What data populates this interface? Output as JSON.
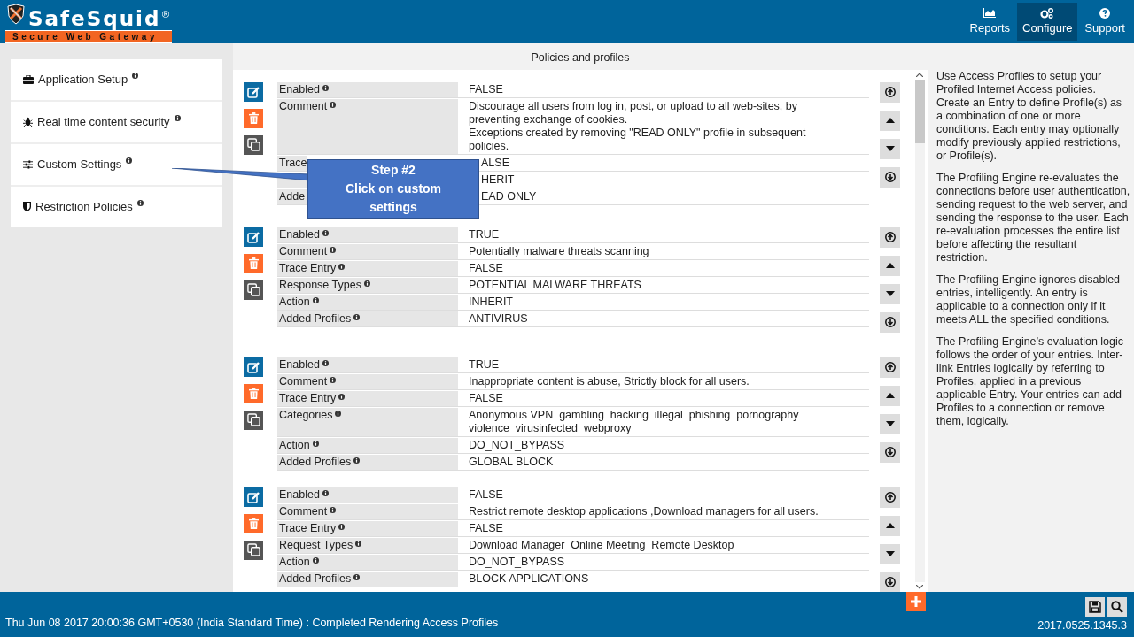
{
  "header": {
    "logo_name": "SafeSquid",
    "logo_mark": "®",
    "logo_tagline": "Secure Web Gateway",
    "nav": [
      {
        "label": "Reports",
        "selected": false
      },
      {
        "label": "Configure",
        "selected": true
      },
      {
        "label": "Support",
        "selected": false
      }
    ]
  },
  "sidebar": {
    "items": [
      {
        "label": "Application Setup"
      },
      {
        "label": "Real time content security"
      },
      {
        "label": "Custom Settings"
      },
      {
        "label": "Restriction Policies"
      }
    ]
  },
  "panel": {
    "title": "Policies and profiles",
    "entries": [
      {
        "rows": [
          {
            "label": "Enabled",
            "value": "FALSE",
            "covered": false
          },
          {
            "label": "Comment",
            "value": "Discourage all users from log in, post, or upload to all web-sites, by preventing exchange of cookies.\nExceptions created by removing \"READ ONLY\" profile in subsequent policies.",
            "covered": false
          },
          {
            "label": "Trace",
            "value": "ALSE",
            "covered": true
          },
          {
            "value": "HERIT",
            "covered": true
          },
          {
            "label": "Adde",
            "value": "EAD ONLY",
            "covered": true
          }
        ]
      },
      {
        "rows": [
          {
            "label": "Enabled",
            "value": "TRUE",
            "covered": false
          },
          {
            "label": "Comment",
            "value": "Potentially malware threats scanning",
            "covered": false
          },
          {
            "label": "Trace Entry",
            "value": "FALSE",
            "covered": false
          },
          {
            "label": "Response Types",
            "value": "POTENTIAL MALWARE THREATS",
            "covered": false
          },
          {
            "label": "Action",
            "value": "INHERIT",
            "covered": false
          },
          {
            "label": "Added Profiles",
            "value": "ANTIVIRUS",
            "covered": false
          }
        ]
      },
      {
        "rows": [
          {
            "label": "Enabled",
            "value": "TRUE",
            "covered": false
          },
          {
            "label": "Comment",
            "value": "Inappropriate content is abuse, Strictly block for all users.",
            "covered": false
          },
          {
            "label": "Trace Entry",
            "value": "FALSE",
            "covered": false
          },
          {
            "label": "Categories",
            "value": "Anonymous VPN  gambling  hacking  illegal  phishing  pornography\nviolence  virusinfected  webproxy",
            "covered": false
          },
          {
            "label": "Action",
            "value": "DO_NOT_BYPASS",
            "covered": false
          },
          {
            "label": "Added Profiles",
            "value": "GLOBAL BLOCK",
            "covered": false
          }
        ]
      },
      {
        "rows": [
          {
            "label": "Enabled",
            "value": "FALSE",
            "covered": false
          },
          {
            "label": "Comment",
            "value": "Restrict remote desktop applications ,Download managers for all users.",
            "covered": false
          },
          {
            "label": "Trace Entry",
            "value": "FALSE",
            "covered": false
          },
          {
            "label": "Request Types",
            "value": "Download Manager  Online Meeting  Remote Desktop",
            "covered": false
          },
          {
            "label": "Action",
            "value": "DO_NOT_BYPASS",
            "covered": false
          },
          {
            "label": "Added Profiles",
            "value": "BLOCK APPLICATIONS",
            "covered": false
          }
        ]
      }
    ]
  },
  "callout": {
    "title": "Step #2",
    "text": "Click on custom settings"
  },
  "help": [
    "Use Access Profiles to setup your Profiled Internet Access policies. Create an Entry to define Profile(s) as a combination of one or more conditions. Each entry may optionally modify previously applied restrictions, or Profile(s).",
    "The Profiling Engine re-evaluates the connections before user authentication, sending request to the web server, and sending the response to the user. Each re-evaluation processes the entire list before affecting the resultant restriction.",
    "The Profiling Engine ignores disabled entries, intelligently. An entry is applicable to a connection only if it meets ALL the specified conditions.",
    "The Profiling Engine’s evaluation logic follows the order of your entries. Inter-link Entries logically by referring to Profiles, applied in a previous applicable Entry. Your entries can add Profiles to a connection or remove them, logically."
  ],
  "status_bar": {
    "message": "Thu Jun 08 2017 20:00:36 GMT+0530 (India Standard Time) : Completed Rendering Access Profiles",
    "version": "2017.0525.1345.3"
  }
}
